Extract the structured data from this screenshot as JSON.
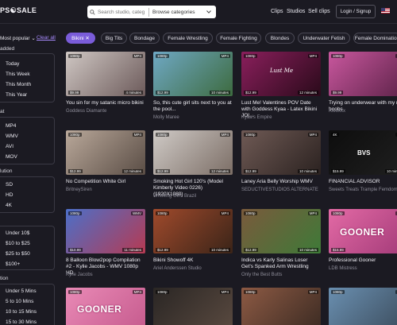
{
  "header": {
    "logo": "PS☯SALE",
    "search_placeholder": "Search studio, categ",
    "browse_label": "Browse categories",
    "nav": [
      "Clips",
      "Studios",
      "Sell clips"
    ],
    "login_label": "Login / Signup"
  },
  "sidebar": {
    "sort_label": "Most popular ⌄",
    "clear_label": "Clear all",
    "added_title": "added",
    "added_options": [
      "Today",
      "This Week",
      "This Month",
      "This Year"
    ],
    "format_title": "at",
    "format_options": [
      "MP4",
      "WMV",
      "AVI",
      "MOV"
    ],
    "resolution_title": "lution",
    "resolution_options": [
      "SD",
      "HD",
      "4K"
    ],
    "price_title": "",
    "price_options": [
      "Under 10$",
      "$10 to $25",
      "$25 to $50",
      "$100+"
    ],
    "duration_title": "tion",
    "duration_options": [
      "Under 5 Mins",
      "5 to 10 Mins",
      "10 to 15 Mins",
      "15 to 30 Mins"
    ]
  },
  "chips": [
    "Bikini ✕",
    "Big Tits",
    "Bondage",
    "Female Wrestling",
    "Female Fighting",
    "Blondes",
    "Underwater Fetish",
    "Female Domination"
  ],
  "cards": [
    {
      "res": "1080p",
      "fmt": "MP4",
      "price": "$9.99",
      "dur": "4 minutes",
      "title": "You sin for my satanic micro bikini",
      "studio": "Goddess Diamante",
      "c1": "#cfc7c3",
      "c2": "#6c5a5a"
    },
    {
      "res": "1080p",
      "fmt": "MP4",
      "price": "$12.99",
      "dur": "10 minutes",
      "title": "So, this cute girl sits next to you at the pool...",
      "studio": "Molly Maree",
      "c1": "#6fa8c4",
      "c2": "#3d6b3f"
    },
    {
      "res": "1080p",
      "fmt": "MP4",
      "price": "$12.99",
      "dur": "12 minutes",
      "title": "Lust Me! Valentines POV Date with Goddess Kyaa - Latex Bikini JOI...",
      "studio": "Kyaa's Empire",
      "c1": "#8a1f5c",
      "c2": "#2a0a1a"
    },
    {
      "res": "1080p",
      "fmt": "MP4",
      "price": "$9.99",
      "dur": "",
      "title": "Trying on underwear with my ne boobs",
      "studio": "Kleoxxx",
      "c1": "#c9579e",
      "c2": "#5b2247"
    },
    {
      "res": "1080p",
      "fmt": "MP4",
      "price": "$12.99",
      "dur": "12 minutes",
      "title": "No Competition White Girl",
      "studio": "BritneySiren",
      "c1": "#b9a89a",
      "c2": "#5a4d45"
    },
    {
      "res": "1080p",
      "fmt": "MP4",
      "price": "$12.99",
      "dur": "12 minutes",
      "title": "Smoking Hot Girl 120's (Model Kimberly Video 0226) (1920X1080)",
      "studio": "Smoking Girls Brazil",
      "c1": "#cfcac6",
      "c2": "#7c6e66"
    },
    {
      "res": "1080p",
      "fmt": "MP4",
      "price": "$12.99",
      "dur": "10 minutes",
      "title": "Laney Aria Belly Worship WMV",
      "studio": "SEDUCTIVESTUDIOS ALTERNATE",
      "c1": "#6f5a55",
      "c2": "#2b2220"
    },
    {
      "res": "4K",
      "fmt": "MP4",
      "price": "$15.99",
      "dur": "10 minutes",
      "title": "FINANCIAL ADVISOR",
      "studio": "Sweets Treats Trample Femdom",
      "c1": "#0d0d0d",
      "c2": "#202020"
    },
    {
      "res": "1080p",
      "fmt": "WMV",
      "price": "$10.99",
      "dur": "11 minutes",
      "title": "8 Balloon Blow2pop Compilation #2 - Kylie Jacobs - WMV 1080p HD",
      "studio": "Kylie Jacobs",
      "c1": "#4c6fc8",
      "c2": "#b63a52"
    },
    {
      "res": "1080p",
      "fmt": "MP4",
      "price": "$12.99",
      "dur": "10 minutes",
      "title": "Bikini Showoff 4K",
      "studio": "Ariel Anderssen Studio",
      "c1": "#a04a2c",
      "c2": "#3a2418"
    },
    {
      "res": "1080p",
      "fmt": "MP4",
      "price": "$12.99",
      "dur": "10 minutes",
      "title": "Indica vs Karly Salinas Loser Get's Spanked Arm Wrestling",
      "studio": "Only the Best Butts",
      "c1": "#7a5a3c",
      "c2": "#3e7a38"
    },
    {
      "res": "1080p",
      "fmt": "MP4",
      "price": "$15.99",
      "dur": "",
      "title": "Professional Gooner",
      "studio": "LDB Mistress",
      "c1": "#e36aa5",
      "c2": "#a23a78"
    },
    {
      "res": "1080p",
      "fmt": "MP4",
      "price": "",
      "dur": "",
      "title": "",
      "studio": "",
      "c1": "#e98ab6",
      "c2": "#c55a8d"
    },
    {
      "res": "1080p",
      "fmt": "MP4",
      "price": "",
      "dur": "",
      "title": "",
      "studio": "",
      "c1": "#2a2624",
      "c2": "#5a4a40"
    },
    {
      "res": "1080p",
      "fmt": "MP4",
      "price": "",
      "dur": "",
      "title": "",
      "studio": "",
      "c1": "#8d5a44",
      "c2": "#3a2a22"
    },
    {
      "res": "1080p",
      "fmt": "MP4",
      "price": "",
      "dur": "",
      "title": "",
      "studio": "",
      "c1": "#6a8fb0",
      "c2": "#3a4a5a"
    }
  ],
  "overlays": {
    "card3_text": "Lust Me",
    "card8_text": "BVS",
    "gooner_text": "GOONER"
  }
}
